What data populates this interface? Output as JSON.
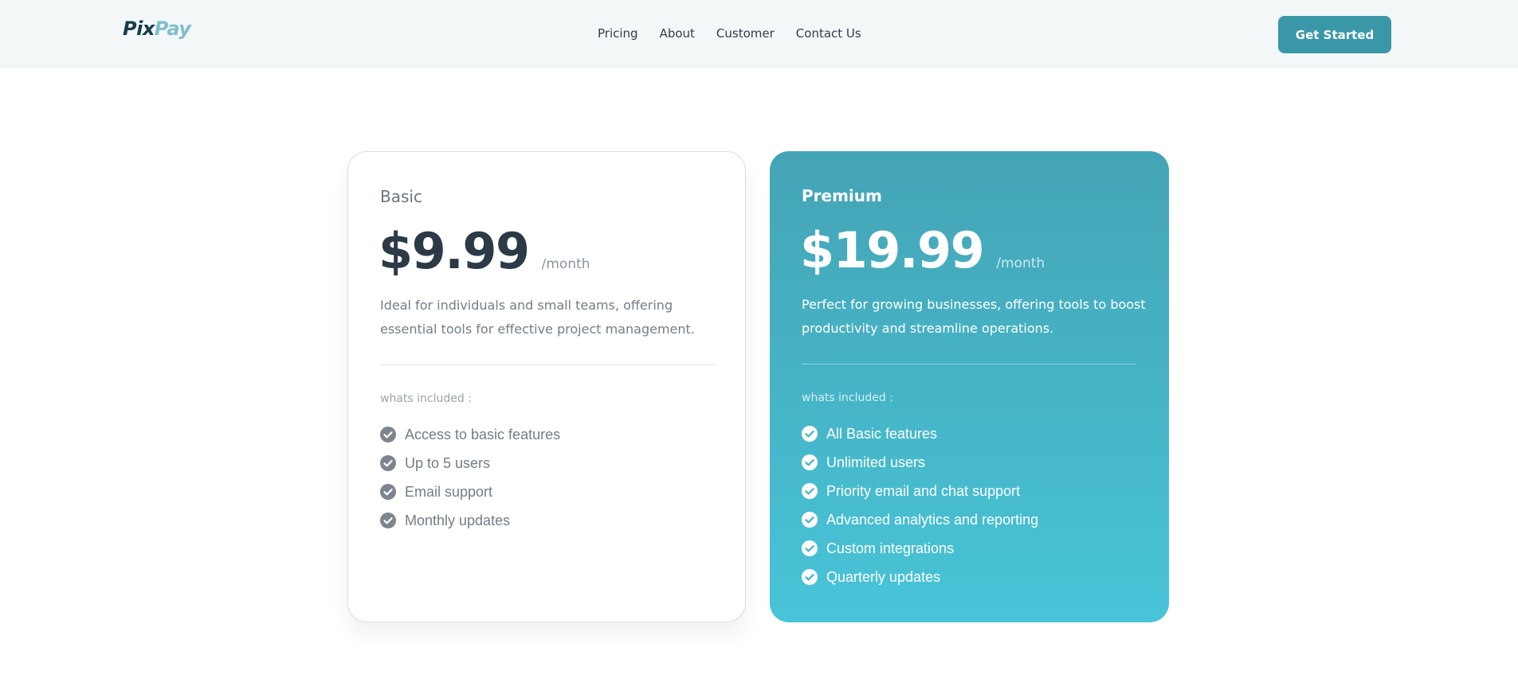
{
  "brand": {
    "logo_part1": "Pix",
    "logo_part2": "Pay"
  },
  "nav": {
    "links": [
      "Pricing",
      "About",
      "Customer",
      "Contact Us"
    ],
    "cta_label": "Get Started"
  },
  "plans": [
    {
      "name": "Basic",
      "price": "$9.99",
      "period": "/month",
      "description": "Ideal for individuals and small teams, offering essential tools for effective project management.",
      "included_label": "whats included :",
      "features": [
        "Access to basic features",
        "Up to 5 users",
        "Email support",
        "Monthly updates"
      ]
    },
    {
      "name": "Premium",
      "price": "$19.99",
      "period": "/month",
      "description": "Perfect for growing businesses, offering tools to boost productivity and streamline operations.",
      "included_label": "whats included :",
      "features": [
        "All Basic features",
        "Unlimited users",
        "Priority email and chat support",
        "Advanced analytics and reporting",
        "Custom integrations",
        "Quarterly updates"
      ]
    }
  ],
  "colors": {
    "accent": "#3a97a8",
    "nav_background": "#f3f7f8",
    "premium_gradient_top": "#44a4b5",
    "premium_gradient_bottom": "#48c4d8",
    "basic_check": "#7d868e",
    "premium_check": "#ffffff"
  },
  "icons": {
    "feature_check": "check-circle-icon"
  }
}
